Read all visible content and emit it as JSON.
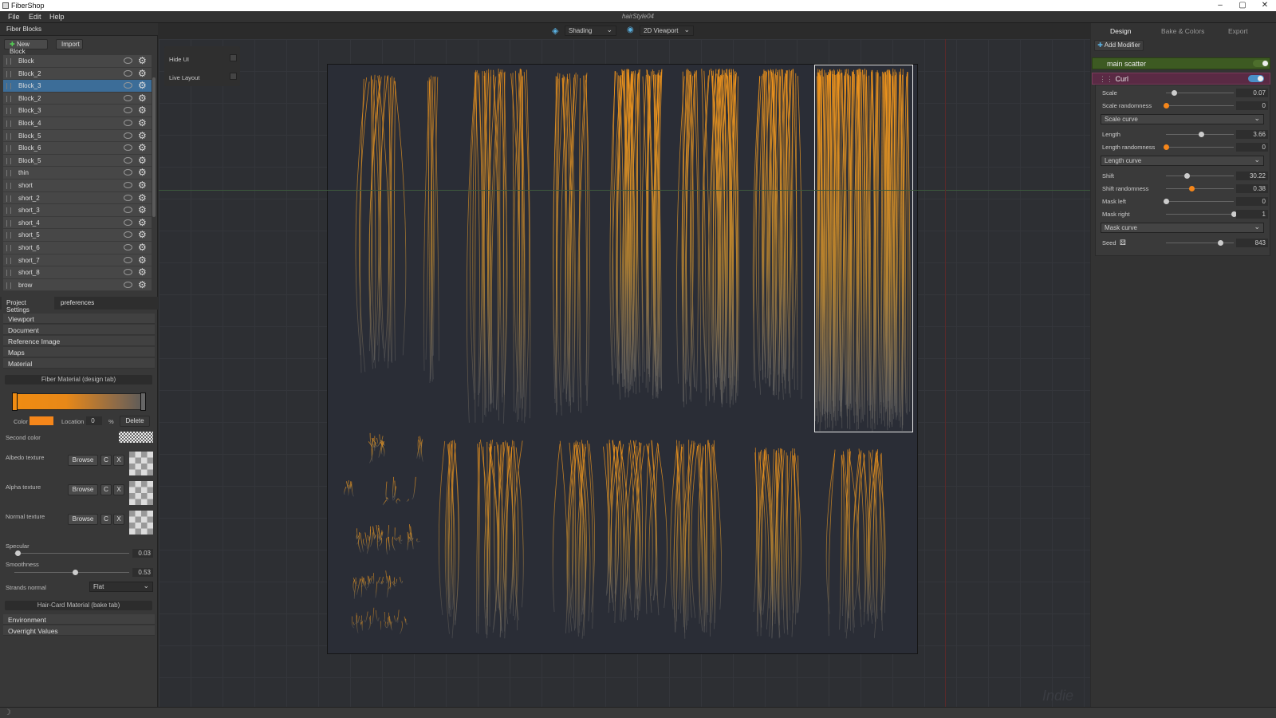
{
  "app": {
    "title": "FiberShop",
    "document": "hairStyle04"
  },
  "window_controls": [
    "–",
    "▢",
    "✕"
  ],
  "menu": [
    "File",
    "Edit",
    "Help"
  ],
  "left": {
    "header": "Fiber Blocks",
    "new_block": "New Block",
    "import": "Import",
    "blocks": [
      {
        "label": "Block"
      },
      {
        "label": "Block_2"
      },
      {
        "label": "Block_3",
        "selected": true
      },
      {
        "label": "Block_2"
      },
      {
        "label": "Block_3"
      },
      {
        "label": "Block_4"
      },
      {
        "label": "Block_5"
      },
      {
        "label": "Block_6"
      },
      {
        "label": "Block_5"
      },
      {
        "label": "thin"
      },
      {
        "label": "short"
      },
      {
        "label": "short_2"
      },
      {
        "label": "short_3"
      },
      {
        "label": "short_4"
      },
      {
        "label": "short_5"
      },
      {
        "label": "short_6"
      },
      {
        "label": "short_7"
      },
      {
        "label": "short_8"
      },
      {
        "label": "brow"
      }
    ],
    "tabs": [
      "Project Settings",
      "preferences"
    ],
    "sections": [
      "Viewport",
      "Document",
      "Reference Image",
      "Maps",
      "Material"
    ],
    "fiber_material_header": "Fiber Material (design tab)",
    "color_label": "Color",
    "color_value": "#f5861a",
    "location_label": "Location",
    "location_value": "0",
    "percent": "%",
    "delete": "Delete",
    "second_color": "Second color",
    "textures": [
      {
        "label": "Albedo texture"
      },
      {
        "label": "Alpha texture"
      },
      {
        "label": "Normal texture"
      }
    ],
    "browse": "Browse",
    "reload_icon": "C",
    "clear_icon": "X",
    "specular": {
      "label": "Specular",
      "value": "0.03",
      "fraction": 0.03
    },
    "smoothness": {
      "label": "Smoothness",
      "value": "0.53",
      "fraction": 0.53
    },
    "strands_normal": {
      "label": "Strands normal",
      "value": "Flat"
    },
    "haircard_header": "Hair-Card Material (bake tab)",
    "extra_sections": [
      "Environment",
      "Overright Values"
    ]
  },
  "toolbar": {
    "shading": "Shading",
    "viewport": "2D Viewport"
  },
  "float": {
    "hide_ui": "Hide UI",
    "live_layout": "Live Layout"
  },
  "watermark": "Indie",
  "right": {
    "tabs": [
      "Design",
      "Bake & Colors",
      "Export"
    ],
    "add_modifier": "Add Modifier",
    "main_scatter": "main scatter",
    "curl": "Curl",
    "props": [
      {
        "label": "Scale",
        "value": "0.07",
        "fraction": 0.12,
        "accent": false
      },
      {
        "label": "Scale randomness",
        "value": "0",
        "fraction": 0.0,
        "accent": true
      },
      {
        "label": "Scale curve",
        "dropdown": true
      },
      {
        "label": "Length",
        "value": "3.66",
        "fraction": 0.52,
        "accent": false
      },
      {
        "label": "Length randomness",
        "value": "0",
        "fraction": 0.0,
        "accent": true
      },
      {
        "label": "Length curve",
        "dropdown": true
      },
      {
        "label": "Shift",
        "value": "30.22",
        "fraction": 0.3,
        "accent": false
      },
      {
        "label": "Shift randomness",
        "value": "0.38",
        "fraction": 0.38,
        "accent": true
      },
      {
        "label": "Mask left",
        "value": "0",
        "fraction": 0.0,
        "accent": false
      },
      {
        "label": "Mask right",
        "value": "1",
        "fraction": 1.0,
        "accent": false
      },
      {
        "label": "Mask curve",
        "dropdown": true
      },
      {
        "label": "Seed",
        "value": "843",
        "fraction": 0.8,
        "accent": false
      }
    ]
  },
  "colors": {
    "accent": "#f5861a",
    "selection": "#3c6d98",
    "scatter_green": "#3d5a22",
    "curl_magenta": "#5a2a44",
    "toggle_blue": "#4a90c8"
  }
}
